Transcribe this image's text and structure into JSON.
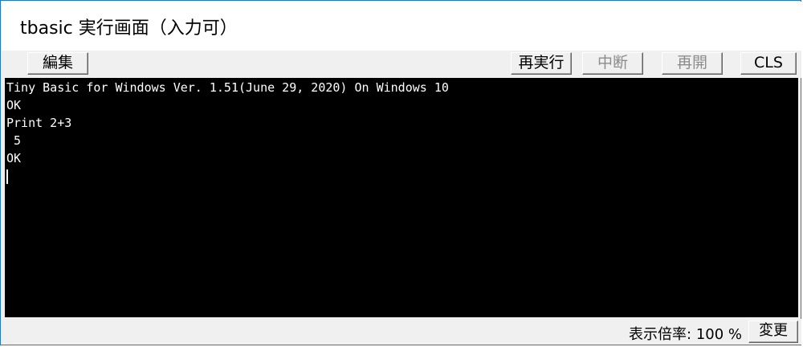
{
  "window": {
    "title": "tbasic 実行画面（入力可）"
  },
  "toolbar": {
    "edit_label": "編集",
    "rerun_label": "再実行",
    "break_label": "中断",
    "resume_label": "再開",
    "cls_label": "CLS"
  },
  "console": {
    "lines": [
      "Tiny Basic for Windows Ver. 1.51(June 29, 2020) On Windows 10",
      "OK",
      "Print 2+3",
      " 5",
      "OK"
    ]
  },
  "status": {
    "zoom_text": "表示倍率: 100 %",
    "change_label": "変更"
  },
  "colors": {
    "window_border": "#1f78d1",
    "console_bg": "#000000",
    "console_fg": "#ffffff",
    "chrome_bg": "#f0f0f0",
    "disabled_text": "#8c8c8c"
  }
}
